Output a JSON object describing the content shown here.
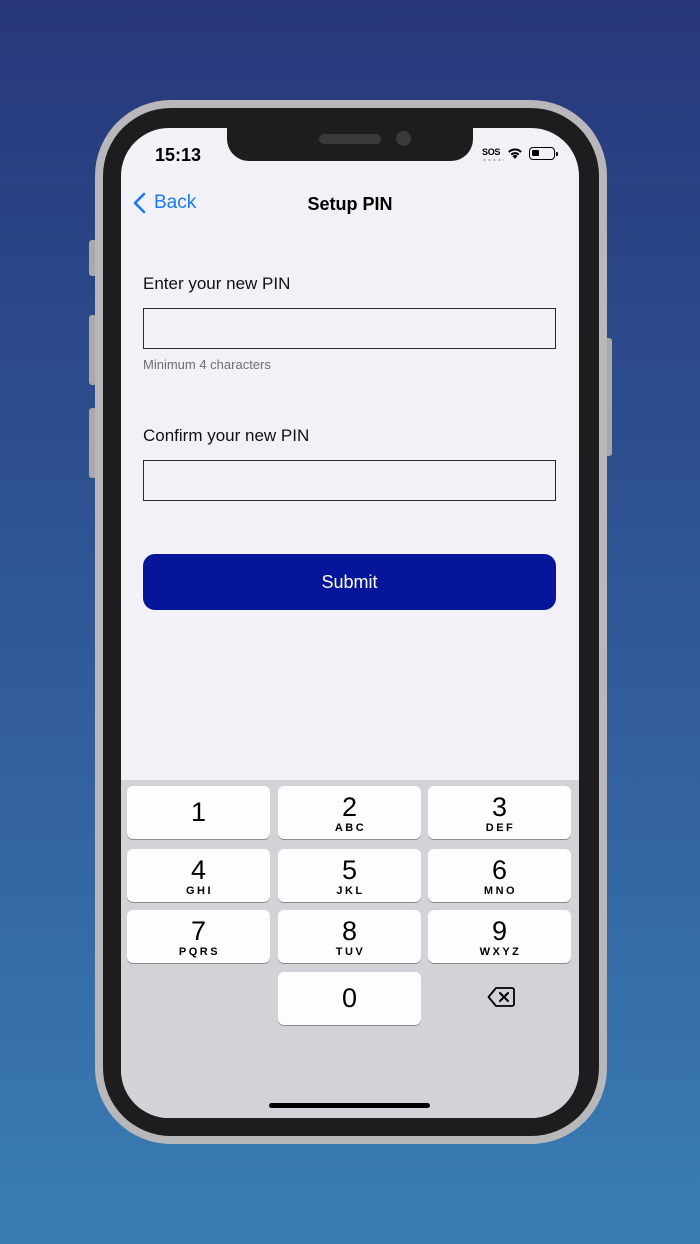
{
  "status_bar": {
    "time": "15:13",
    "sos": "SOS"
  },
  "nav": {
    "back_label": "Back",
    "title": "Setup PIN"
  },
  "form": {
    "new_pin": {
      "label": "Enter your new PIN",
      "value": "",
      "hint": "Minimum 4 characters"
    },
    "confirm_pin": {
      "label": "Confirm your new PIN",
      "value": ""
    },
    "submit_label": "Submit"
  },
  "keypad": {
    "keys": [
      {
        "digit": "1",
        "letters": ""
      },
      {
        "digit": "2",
        "letters": "ABC"
      },
      {
        "digit": "3",
        "letters": "DEF"
      },
      {
        "digit": "4",
        "letters": "GHI"
      },
      {
        "digit": "5",
        "letters": "JKL"
      },
      {
        "digit": "6",
        "letters": "MNO"
      },
      {
        "digit": "7",
        "letters": "PQRS"
      },
      {
        "digit": "8",
        "letters": "TUV"
      },
      {
        "digit": "9",
        "letters": "WXYZ"
      },
      {
        "digit": "0",
        "letters": ""
      }
    ],
    "delete_icon": "backspace-icon"
  },
  "colors": {
    "accent": "#1a7af0",
    "submit_bg": "#061599",
    "screen_bg": "#f2f1f7",
    "keyboard_bg": "#d1d3d8"
  }
}
